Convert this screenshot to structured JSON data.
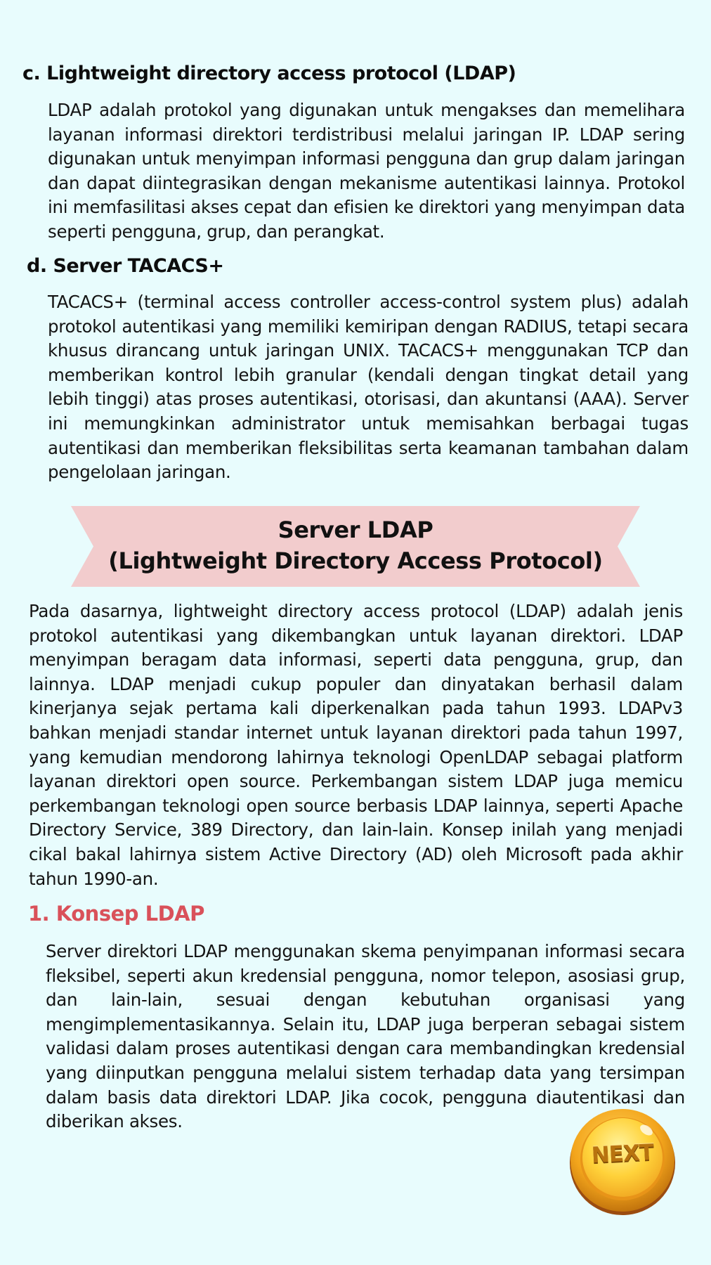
{
  "section_c": {
    "heading": "c. Lightweight directory access protocol (LDAP)",
    "body": "LDAP adalah protokol yang digunakan untuk mengakses dan memelihara layanan informasi direktori terdistribusi melalui jaringan IP. LDAP sering digunakan untuk menyimpan informasi pengguna dan grup dalam jaringan dan dapat diintegrasikan dengan mekanisme autentikasi lainnya. Protokol ini memfasilitasi akses cepat dan efisien ke direktori yang menyimpan data seperti pengguna, grup, dan perangkat."
  },
  "section_d": {
    "heading": "d. Server TACACS+",
    "body": "TACACS+ (terminal access controller access-control system plus) adalah protokol autentikasi yang memiliki kemiripan dengan RADIUS, tetapi secara khusus dirancang untuk jaringan UNIX. TACACS+ menggunakan TCP dan memberikan kontrol lebih granular (kendali dengan tingkat detail yang lebih tinggi) atas proses autentikasi, otorisasi, dan akuntansi (AAA). Server ini memungkinkan administrator untuk memisahkan berbagai tugas autentikasi dan memberikan fleksibilitas serta keamanan tambahan dalam pengelolaan jaringan."
  },
  "banner": {
    "line1": "Server LDAP",
    "line2": "(Lightweight Directory Access Protocol)",
    "color": "#f2cccd"
  },
  "intro": {
    "body": "Pada dasarnya, lightweight directory access protocol (LDAP) adalah jenis protokol autentikasi yang dikembangkan untuk layanan direktori. LDAP menyimpan beragam data informasi, seperti data pengguna, grup, dan lainnya. LDAP menjadi cukup populer dan dinyatakan berhasil dalam kinerjanya sejak pertama kali diperkenalkan pada tahun 1993. LDAPv3 bahkan menjadi standar internet untuk layanan direktori pada tahun 1997, yang kemudian mendorong lahirnya teknologi OpenLDAP sebagai platform layanan direktori open source. Perkembangan sistem LDAP juga memicu perkembangan teknologi open source berbasis LDAP lainnya, seperti Apache Directory Service, 389 Directory, dan lain-lain. Konsep inilah yang menjadi cikal bakal lahirnya sistem Active Directory (AD) oleh Microsoft pada akhir tahun 1990-an."
  },
  "konsep": {
    "heading": "1. Konsep LDAP",
    "heading_color": "#d9515a",
    "body": "Server direktori LDAP menggunakan skema penyimpanan informasi secara fleksibel, seperti akun kredensial pengguna, nomor telepon, asosiasi grup, dan lain-lain, sesuai dengan kebutuhan organisasi yang mengimplementasikannya. Selain itu, LDAP juga berperan sebagai sistem validasi dalam proses autentikasi dengan cara membandingkan kredensial yang diinputkan pengguna melalui sistem terhadap data yang tersimpan dalam basis data direktori LDAP. Jika cocok, pengguna diautentikasi dan diberikan akses."
  },
  "next_button": {
    "label": "NEXT",
    "icon": "gold-coin-button"
  },
  "colors": {
    "background": "#e8fcfd"
  }
}
